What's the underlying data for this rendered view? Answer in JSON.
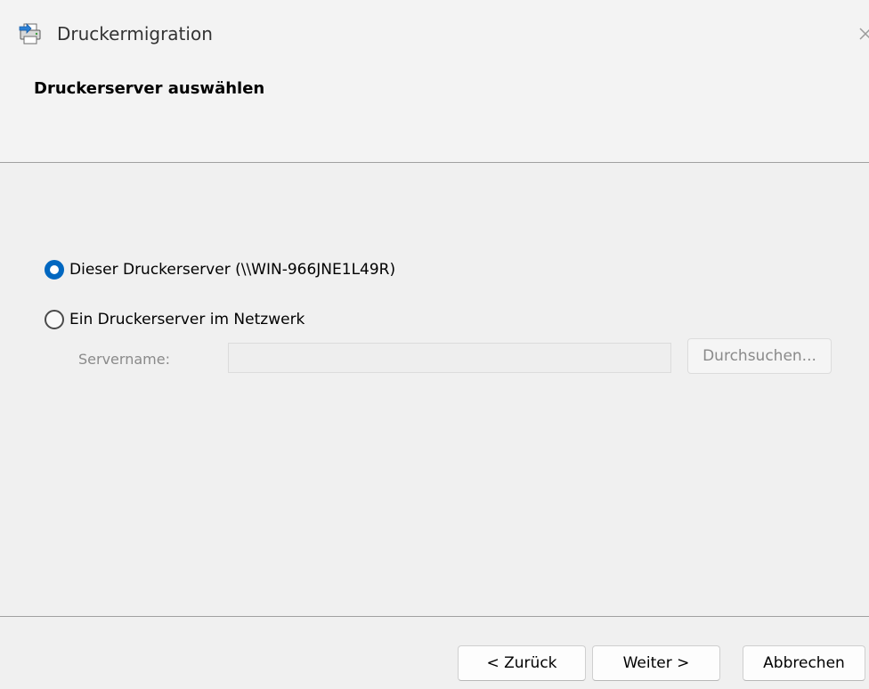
{
  "window": {
    "title": "Druckermigration",
    "icon": "printer-migration-icon",
    "close_glyph": "×"
  },
  "header": {
    "title": "Druckerserver auswählen"
  },
  "options": {
    "local_server_label": "Dieser Druckerserver (\\\\WIN-966JNE1L49R)",
    "local_server_selected": true,
    "network_server_label": "Ein Druckerserver im Netzwerk",
    "network_server_selected": false
  },
  "server": {
    "label": "Servername:",
    "value": "",
    "placeholder": "",
    "browse_label": "Durchsuchen..."
  },
  "footer": {
    "back_label": "< Zurück",
    "next_label": "Weiter >",
    "cancel_label": "Abbrechen"
  },
  "colors": {
    "accent": "#0067c0",
    "background": "#f0f0f0",
    "disabled_text": "#8a8a8a"
  }
}
